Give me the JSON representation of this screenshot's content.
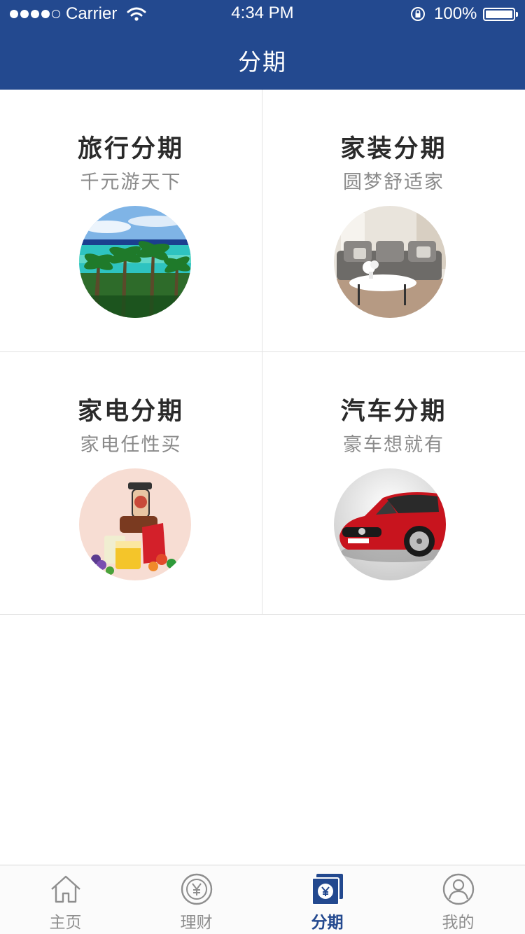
{
  "status_bar": {
    "carrier": "Carrier",
    "time": "4:34 PM",
    "battery": "100%"
  },
  "header": {
    "title": "分期"
  },
  "categories": [
    {
      "title": "旅行分期",
      "subtitle": "千元游天下",
      "image": "tropical-beach-palm-trees"
    },
    {
      "title": "家装分期",
      "subtitle": "圆梦舒适家",
      "image": "living-room-sofa"
    },
    {
      "title": "家电分期",
      "subtitle": "家电任性买",
      "image": "juicer-with-fruit"
    },
    {
      "title": "汽车分期",
      "subtitle": "豪车想就有",
      "image": "red-car"
    }
  ],
  "tabbar": {
    "tabs": [
      {
        "label": "主页",
        "icon": "home-icon"
      },
      {
        "label": "理财",
        "icon": "yen-coin-icon"
      },
      {
        "label": "分期",
        "icon": "installment-card-icon",
        "active": true
      },
      {
        "label": "我的",
        "icon": "user-profile-icon"
      }
    ]
  },
  "colors": {
    "brand_blue": "#23498f",
    "title_text": "#2a2a2a",
    "subtitle_text": "#8a8a8a",
    "tab_inactive": "#8e8e8e"
  }
}
